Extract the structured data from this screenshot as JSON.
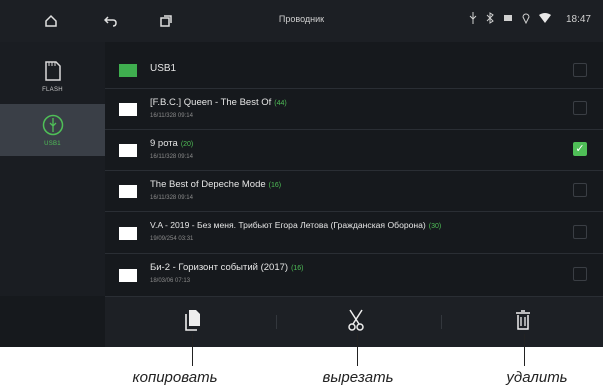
{
  "statusbar": {
    "title": "Проводник",
    "time": "18:47",
    "icons": [
      "home-icon",
      "back-icon",
      "recent-apps-icon",
      "usb-icon",
      "bluetooth-icon",
      "battery-icon",
      "location-icon",
      "wifi-icon"
    ]
  },
  "sidebar": {
    "items": [
      {
        "label": "FLASH",
        "icon": "sd-card-icon",
        "active": false
      },
      {
        "label": "USB1",
        "icon": "usb-drive-icon",
        "active": true
      }
    ]
  },
  "list": {
    "header": {
      "label": "USB1"
    },
    "rows": [
      {
        "name": "[F.B.C.] Queen - The Best Of",
        "count": "(44)",
        "date": "16/11/328 09:14",
        "checked": false
      },
      {
        "name": "9 рота",
        "count": "(20)",
        "date": "16/11/328 09:14",
        "checked": true
      },
      {
        "name": "The Best of Depeche Mode",
        "count": "(16)",
        "date": "16/11/328 09:14",
        "checked": false
      },
      {
        "name": "V.A - 2019 - Без меня. Трибьют Егора Летова (Гражданская Оборона)",
        "count": "(30)",
        "date": "19/09/254 03:31",
        "checked": false
      },
      {
        "name": "Би-2 - Горизонт событий (2017)",
        "count": "(16)",
        "date": "18/03/06 07:13",
        "checked": false
      }
    ]
  },
  "colors": {
    "accent": "#4fbf57",
    "folder_header": "#3fae4f",
    "folder": "#ffffff"
  },
  "callouts": {
    "copy": "копировать",
    "cut": "вырезать",
    "delete": "удалить"
  }
}
